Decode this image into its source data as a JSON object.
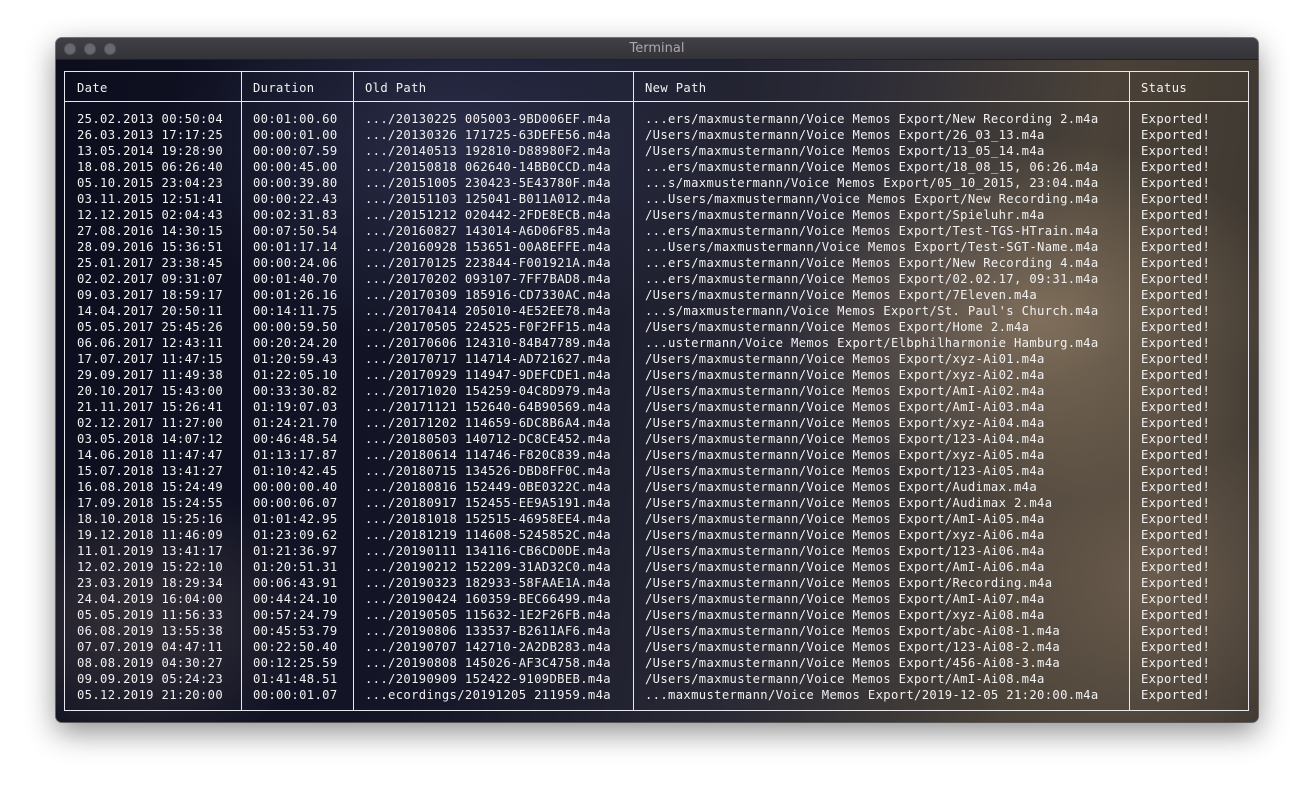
{
  "window": {
    "title": "Terminal"
  },
  "table": {
    "columns": [
      "Date",
      "Duration",
      "Old Path",
      "New Path",
      "Status"
    ],
    "rows": [
      [
        "25.02.2013 00:50:04",
        "00:01:00.60",
        ".../20130225 005003-9BD006EF.m4a",
        "...ers/maxmustermann/Voice Memos Export/New Recording 2.m4a",
        "Exported!"
      ],
      [
        "26.03.2013 17:17:25",
        "00:00:01.00",
        ".../20130326 171725-63DEFE56.m4a",
        "/Users/maxmustermann/Voice Memos Export/26_03_13.m4a",
        "Exported!"
      ],
      [
        "13.05.2014 19:28:90",
        "00:00:07.59",
        ".../20140513 192810-D88980F2.m4a",
        "/Users/maxmustermann/Voice Memos Export/13_05_14.m4a",
        "Exported!"
      ],
      [
        "18.08.2015 06:26:40",
        "00:00:45.00",
        ".../20150818 062640-14BB0CCD.m4a",
        "...ers/maxmustermann/Voice Memos Export/18_08_15, 06:26.m4a",
        "Exported!"
      ],
      [
        "05.10.2015 23:04:23",
        "00:00:39.80",
        ".../20151005 230423-5E43780F.m4a",
        "...s/maxmustermann/Voice Memos Export/05_10_2015, 23:04.m4a",
        "Exported!"
      ],
      [
        "03.11.2015 12:51:41",
        "00:00:22.43",
        ".../20151103 125041-B011A012.m4a",
        "...Users/maxmustermann/Voice Memos Export/New Recording.m4a",
        "Exported!"
      ],
      [
        "12.12.2015 02:04:43",
        "00:02:31.83",
        ".../20151212 020442-2FDE8ECB.m4a",
        "/Users/maxmustermann/Voice Memos Export/Spieluhr.m4a",
        "Exported!"
      ],
      [
        "27.08.2016 14:30:15",
        "00:07:50.54",
        ".../20160827 143014-A6D06F85.m4a",
        "...ers/maxmustermann/Voice Memos Export/Test-TGS-HTrain.m4a",
        "Exported!"
      ],
      [
        "28.09.2016 15:36:51",
        "00:01:17.14",
        ".../20160928 153651-00A8EFFE.m4a",
        "...Users/maxmustermann/Voice Memos Export/Test-SGT-Name.m4a",
        "Exported!"
      ],
      [
        "25.01.2017 23:38:45",
        "00:00:24.06",
        ".../20170125 223844-F001921A.m4a",
        "...ers/maxmustermann/Voice Memos Export/New Recording 4.m4a",
        "Exported!"
      ],
      [
        "02.02.2017 09:31:07",
        "00:01:40.70",
        ".../20170202 093107-7FF7BAD8.m4a",
        "...ers/maxmustermann/Voice Memos Export/02.02.17, 09:31.m4a",
        "Exported!"
      ],
      [
        "09.03.2017 18:59:17",
        "00:01:26.16",
        ".../20170309 185916-CD7330AC.m4a",
        "/Users/maxmustermann/Voice Memos Export/7Eleven.m4a",
        "Exported!"
      ],
      [
        "14.04.2017 20:50:11",
        "00:14:11.75",
        ".../20170414 205010-4E52EE78.m4a",
        "...s/maxmustermann/Voice Memos Export/St. Paul's Church.m4a",
        "Exported!"
      ],
      [
        "05.05.2017 25:45:26",
        "00:00:59.50",
        ".../20170505 224525-F0F2FF15.m4a",
        "/Users/maxmustermann/Voice Memos Export/Home 2.m4a",
        "Exported!"
      ],
      [
        "06.06.2017 12:43:11",
        "00:20:24.20",
        ".../20170606 124310-84B47789.m4a",
        "...ustermann/Voice Memos Export/Elbphilharmonie Hamburg.m4a",
        "Exported!"
      ],
      [
        "17.07.2017 11:47:15",
        "01:20:59.43",
        ".../20170717 114714-AD721627.m4a",
        "/Users/maxmustermann/Voice Memos Export/xyz-Ai01.m4a",
        "Exported!"
      ],
      [
        "29.09.2017 11:49:38",
        "01:22:05.10",
        ".../20170929 114947-9DEFCDE1.m4a",
        "/Users/maxmustermann/Voice Memos Export/xyz-Ai02.m4a",
        "Exported!"
      ],
      [
        "20.10.2017 15:43:00",
        "00:33:30.82",
        ".../20171020 154259-04C8D979.m4a",
        "/Users/maxmustermann/Voice Memos Export/AmI-Ai02.m4a",
        "Exported!"
      ],
      [
        "21.11.2017 15:26:41",
        "01:19:07.03",
        ".../20171121 152640-64B90569.m4a",
        "/Users/maxmustermann/Voice Memos Export/AmI-Ai03.m4a",
        "Exported!"
      ],
      [
        "02.12.2017 11:27:00",
        "01:24:21.70",
        ".../20171202 114659-6DC8B6A4.m4a",
        "/Users/maxmustermann/Voice Memos Export/xyz-Ai04.m4a",
        "Exported!"
      ],
      [
        "03.05.2018 14:07:12",
        "00:46:48.54",
        ".../20180503 140712-DC8CE452.m4a",
        "/Users/maxmustermann/Voice Memos Export/123-Ai04.m4a",
        "Exported!"
      ],
      [
        "14.06.2018 11:47:47",
        "01:13:17.87",
        ".../20180614 114746-F820C839.m4a",
        "/Users/maxmustermann/Voice Memos Export/xyz-Ai05.m4a",
        "Exported!"
      ],
      [
        "15.07.2018 13:41:27",
        "01:10:42.45",
        ".../20180715 134526-DBD8FF0C.m4a",
        "/Users/maxmustermann/Voice Memos Export/123-Ai05.m4a",
        "Exported!"
      ],
      [
        "16.08.2018 15:24:49",
        "00:00:00.40",
        ".../20180816 152449-0BE0322C.m4a",
        "/Users/maxmustermann/Voice Memos Export/Audimax.m4a",
        "Exported!"
      ],
      [
        "17.09.2018 15:24:55",
        "00:00:06.07",
        ".../20180917 152455-EE9A5191.m4a",
        "/Users/maxmustermann/Voice Memos Export/Audimax 2.m4a",
        "Exported!"
      ],
      [
        "18.10.2018 15:25:16",
        "01:01:42.95",
        ".../20181018 152515-46958EE4.m4a",
        "/Users/maxmustermann/Voice Memos Export/AmI-Ai05.m4a",
        "Exported!"
      ],
      [
        "19.12.2018 11:46:09",
        "01:23:09.62",
        ".../20181219 114608-5245852C.m4a",
        "/Users/maxmustermann/Voice Memos Export/xyz-Ai06.m4a",
        "Exported!"
      ],
      [
        "11.01.2019 13:41:17",
        "01:21:36.97",
        ".../20190111 134116-CB6CD0DE.m4a",
        "/Users/maxmustermann/Voice Memos Export/123-Ai06.m4a",
        "Exported!"
      ],
      [
        "12.02.2019 15:22:10",
        "01:20:51.31",
        ".../20190212 152209-31AD32C0.m4a",
        "/Users/maxmustermann/Voice Memos Export/AmI-Ai06.m4a",
        "Exported!"
      ],
      [
        "23.03.2019 18:29:34",
        "00:06:43.91",
        ".../20190323 182933-58FAAE1A.m4a",
        "/Users/maxmustermann/Voice Memos Export/Recording.m4a",
        "Exported!"
      ],
      [
        "24.04.2019 16:04:00",
        "00:44:24.10",
        ".../20190424 160359-BEC66499.m4a",
        "/Users/maxmustermann/Voice Memos Export/AmI-Ai07.m4a",
        "Exported!"
      ],
      [
        "05.05.2019 11:56:33",
        "00:57:24.79",
        ".../20190505 115632-1E2F26FB.m4a",
        "/Users/maxmustermann/Voice Memos Export/xyz-Ai08.m4a",
        "Exported!"
      ],
      [
        "06.08.2019 13:55:38",
        "00:45:53.79",
        ".../20190806 133537-B2611AF6.m4a",
        "/Users/maxmustermann/Voice Memos Export/abc-Ai08-1.m4a",
        "Exported!"
      ],
      [
        "07.07.2019 04:47:11",
        "00:22:50.40",
        ".../20190707 142710-2A2DB283.m4a",
        "/Users/maxmustermann/Voice Memos Export/123-Ai08-2.m4a",
        "Exported!"
      ],
      [
        "08.08.2019 04:30:27",
        "00:12:25.59",
        ".../20190808 145026-AF3C4758.m4a",
        "/Users/maxmustermann/Voice Memos Export/456-Ai08-3.m4a",
        "Exported!"
      ],
      [
        "09.09.2019 05:24:23",
        "01:41:48.51",
        ".../20190909 152422-9109DBEB.m4a",
        "/Users/maxmustermann/Voice Memos Export/AmI-Ai08.m4a",
        "Exported!"
      ],
      [
        "05.12.2019 21:20:00",
        "00:00:01.07",
        "...ecordings/20191205 211959.m4a",
        "...maxmustermann/Voice Memos Export/2019-12-05 21:20:00.m4a",
        "Exported!"
      ]
    ]
  }
}
